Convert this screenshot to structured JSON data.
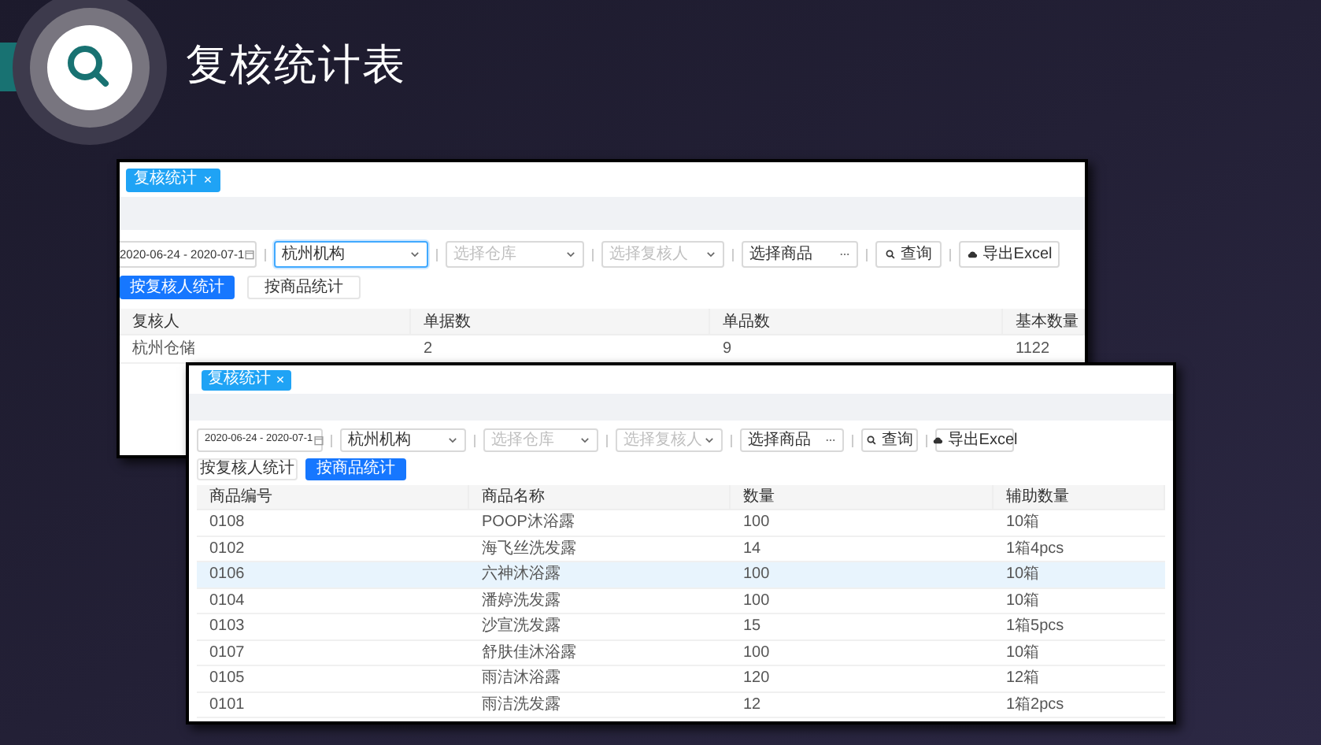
{
  "slide": {
    "title": "复核统计表"
  },
  "screenshots": [
    {
      "tab": "复核统计",
      "filters": {
        "date_range": "2020-06-24 - 2020-07-1",
        "organization": {
          "value": "杭州机构",
          "focused": true
        },
        "warehouse": {
          "placeholder": "选择仓库"
        },
        "reviewer": {
          "placeholder": "选择复核人"
        },
        "product": {
          "value": "选择商品"
        }
      },
      "buttons": [
        "查询",
        "导出Excel"
      ],
      "modes": [
        {
          "label": "按复核人统计",
          "selected": true
        },
        {
          "label": "按商品统计",
          "selected": false
        }
      ],
      "table": {
        "columns": [
          "复核人",
          "单据数",
          "单品数",
          "基本数量"
        ],
        "rows": [
          {
            "cells": [
              "杭州仓储",
              "2",
              "9",
              "1122"
            ],
            "highlighted": false
          }
        ]
      }
    },
    {
      "tab": "复核统计",
      "filters": {
        "date_range": "2020-06-24 - 2020-07-1",
        "organization": {
          "value": "杭州机构",
          "focused": false
        },
        "warehouse": {
          "placeholder": "选择仓库"
        },
        "reviewer": {
          "placeholder": "选择复核人"
        },
        "product": {
          "value": "选择商品"
        }
      },
      "buttons": [
        "查询",
        "导出Excel"
      ],
      "modes": [
        {
          "label": "按复核人统计",
          "selected": false
        },
        {
          "label": "按商品统计",
          "selected": true
        }
      ],
      "table": {
        "columns": [
          "商品编号",
          "商品名称",
          "数量",
          "辅助数量"
        ],
        "rows": [
          {
            "cells": [
              "0108",
              "POOP沐浴露",
              "100",
              "10箱"
            ],
            "highlighted": false
          },
          {
            "cells": [
              "0102",
              "海飞丝洗发露",
              "14",
              "1箱4pcs"
            ],
            "highlighted": false
          },
          {
            "cells": [
              "0106",
              "六神沐浴露",
              "100",
              "10箱"
            ],
            "highlighted": true
          },
          {
            "cells": [
              "0104",
              "潘婷洗发露",
              "100",
              "10箱"
            ],
            "highlighted": false
          },
          {
            "cells": [
              "0103",
              "沙宣洗发露",
              "15",
              "1箱5pcs"
            ],
            "highlighted": false
          },
          {
            "cells": [
              "0107",
              "舒肤佳沐浴露",
              "100",
              "10箱"
            ],
            "highlighted": false
          },
          {
            "cells": [
              "0105",
              "雨洁沐浴露",
              "120",
              "12箱"
            ],
            "highlighted": false
          },
          {
            "cells": [
              "0101",
              "雨洁洗发露",
              "12",
              "1箱2pcs"
            ],
            "highlighted": false
          }
        ]
      }
    }
  ]
}
